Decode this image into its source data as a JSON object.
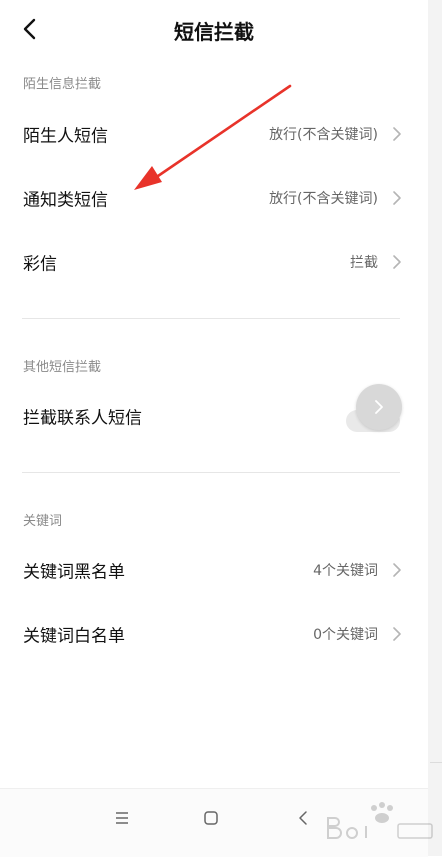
{
  "header": {
    "title": "短信拦截",
    "back_icon": "chevron-left-icon"
  },
  "sections": {
    "stranger": {
      "title": "陌生信息拦截",
      "rows": [
        {
          "label": "陌生人短信",
          "value": "放行(不含关键词)"
        },
        {
          "label": "通知类短信",
          "value": "放行(不含关键词)"
        },
        {
          "label": "彩信",
          "value": "拦截"
        }
      ]
    },
    "other": {
      "title": "其他短信拦截",
      "rows": [
        {
          "label": "拦截联系人短信",
          "toggle_on": false
        }
      ]
    },
    "keywords": {
      "title": "关键词",
      "rows": [
        {
          "label": "关键词黑名单",
          "value": "4个关键词"
        },
        {
          "label": "关键词白名单",
          "value": "0个关键词"
        }
      ]
    }
  },
  "navbar": {
    "icons": [
      "menu-icon",
      "home-square-icon",
      "back-triangle-icon"
    ]
  },
  "annotation": {
    "arrow_color": "#e8332a"
  },
  "colors": {
    "text": "#111111",
    "secondary": "#8a8a8a",
    "value": "#666666"
  }
}
